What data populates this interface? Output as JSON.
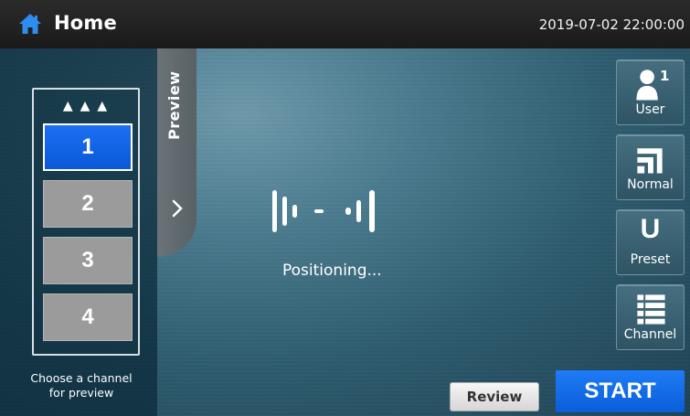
{
  "header": {
    "title": "Home",
    "datetime": "2019-07-02 22:00:00",
    "home_icon": "home-icon"
  },
  "channels": {
    "arrows": "▲▲▲",
    "items": [
      {
        "label": "1",
        "active": true
      },
      {
        "label": "2",
        "active": false
      },
      {
        "label": "3",
        "active": false
      },
      {
        "label": "4",
        "active": false
      }
    ],
    "hint_line1": "Choose a channel",
    "hint_line2": "for preview"
  },
  "preview": {
    "label": "Preview",
    "chevron_icon": "chevron-right-icon"
  },
  "status": {
    "text": "Positioning...",
    "icon": "positioning-signal-icon"
  },
  "side_buttons": {
    "user": {
      "label": "User",
      "count": "1",
      "icon": "user-icon"
    },
    "normal": {
      "label": "Normal",
      "icon": "mode-normal-icon"
    },
    "preset": {
      "label": "Preset",
      "glyph": "U",
      "icon": "preset-u-icon"
    },
    "channel": {
      "label": "Channel",
      "icon": "channel-list-icon"
    }
  },
  "actions": {
    "review_label": "Review",
    "start_label": "START"
  },
  "colors": {
    "accent_blue": "#0a5ed8",
    "top_bar": "#1f1f1f",
    "inactive_channel": "#9b9b9b"
  }
}
